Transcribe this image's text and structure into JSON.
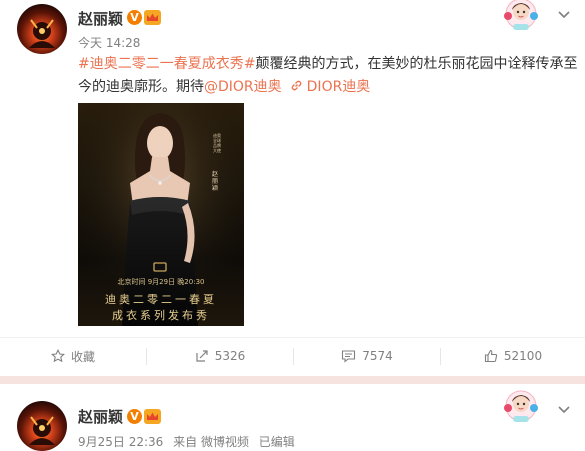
{
  "colors": {
    "accent": "#eb7350",
    "vip_orange": "#f37e00",
    "muted": "#808080"
  },
  "posts": [
    {
      "author": "赵丽颖",
      "verified_badge": "V",
      "time": "今天 14:28",
      "content": {
        "hashtag": "#迪奥二零二一春夏成衣秀#",
        "text1": "颠覆经典的方式，在美妙的杜乐丽花园中诠释传承至今的迪奥廓形。期待",
        "mention": "@DIOR迪奥",
        "link_label": "DIOR迪奥"
      },
      "poster": {
        "side_caption": "迪奥全球品牌大使",
        "side_name": "赵丽颖",
        "date_line": "北京时间 9月29日 晚20:30",
        "title_line1": "迪奥二零二一春夏",
        "title_line2": "成衣系列发布秀"
      },
      "actions": {
        "favorite": "收藏",
        "repost": "5326",
        "comment": "7574",
        "like": "52100"
      }
    },
    {
      "author": "赵丽颖",
      "verified_badge": "V",
      "time": "9月25日 22:36",
      "source": "来自 微博视频",
      "edited": "已编辑"
    }
  ]
}
